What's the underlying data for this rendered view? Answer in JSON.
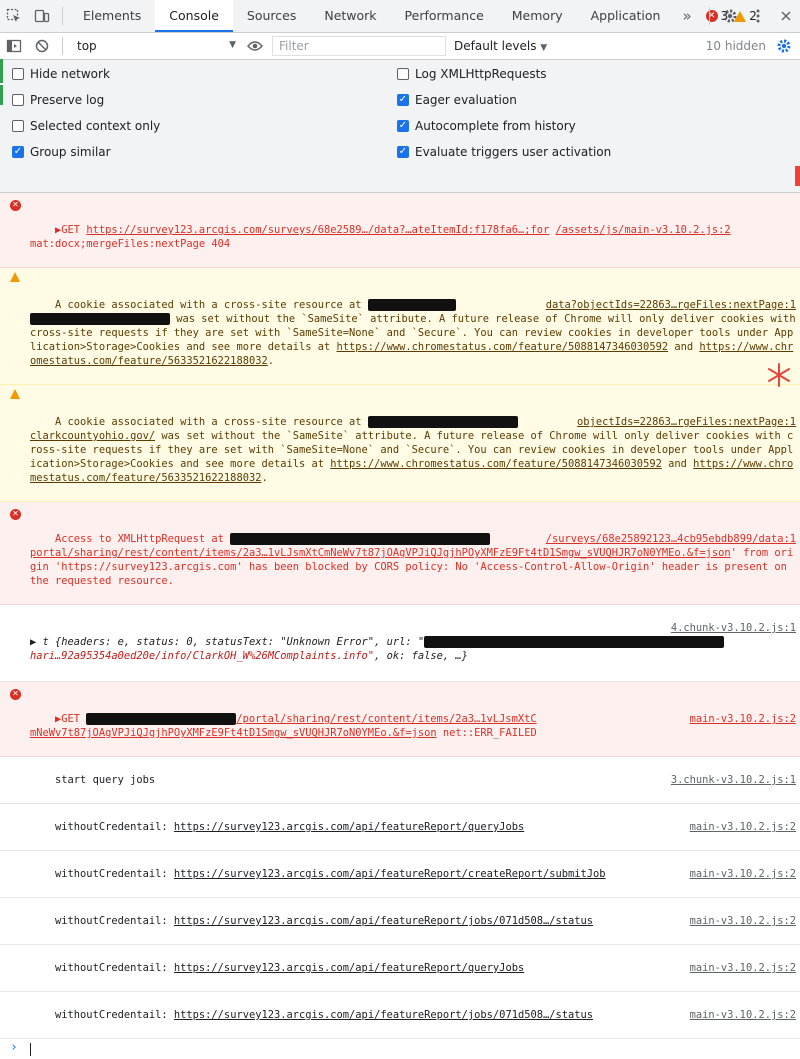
{
  "tabs": [
    "Elements",
    "Console",
    "Sources",
    "Network",
    "Performance",
    "Memory",
    "Application"
  ],
  "active_tab": "Console",
  "more_tabs": "»",
  "error_count": "3",
  "warning_count": "2",
  "toolbar": {
    "context": "top",
    "filter_placeholder": "Filter",
    "levels": "Default levels",
    "hidden": "10 hidden"
  },
  "settings": {
    "left": [
      {
        "label": "Hide network",
        "checked": false
      },
      {
        "label": "Preserve log",
        "checked": false
      },
      {
        "label": "Selected context only",
        "checked": false
      },
      {
        "label": "Group similar",
        "checked": true
      }
    ],
    "right": [
      {
        "label": "Log XMLHttpRequests",
        "checked": false
      },
      {
        "label": "Eager evaluation",
        "checked": true
      },
      {
        "label": "Autocomplete from history",
        "checked": true
      },
      {
        "label": "Evaluate triggers user activation",
        "checked": true
      }
    ]
  },
  "messages": {
    "m1": {
      "prefix": "▶GET ",
      "url": "https://survey123.arcgis.com/surveys/68e2589…/data?…ateItemId:f178fa6…;for",
      "mid": " ",
      "src": "/assets/js/main-v3.10.2.js:2",
      "tail": "mat:docx;mergeFiles:nextPage 404"
    },
    "m2": {
      "line1": "A cookie associated with a cross-site resource at ",
      "src": "data?objectIds=22863…rgeFiles:nextPage:1",
      "line2": " was set without the `SameSite` attribute. A future release of Chrome will only deliver cookies with cross-site requests if they are set with `SameSite=None` and `Secure`. You can review cookies in developer tools under Application>Storage>Cookies and see more details at ",
      "link1": "https://www.chromestatus.com/feature/5088147346030592",
      "and": " and ",
      "link2": "https://www.chromestatus.com/feature/5633521622188032",
      "end": "."
    },
    "m3": {
      "line1": "A cookie associated with a cross-site resource at ",
      "src": "objectIds=22863…rgeFiles:nextPage:1",
      "domain": "clarkcountyohio.gov/",
      "line2": " was set without the `SameSite` attribute. A future release of Chrome will only deliver cookies with cross-site requests if they are set with `SameSite=None` and `Secure`. You can review cookies in developer tools under Application>Storage>Cookies and see more details at ",
      "link1": "https://www.chromestatus.com/feature/5088147346030592",
      "and": " and ",
      "link2": "https://www.chromestatus.com/feature/5633521622188032",
      "end": "."
    },
    "m4": {
      "start": "Access to XMLHttpRequest at ",
      "src": "/surveys/68e25892123…4cb95ebdb899/data:1",
      "url": "portal/sharing/rest/content/items/2a3…1vLJsmXtCmNeWv7t87jOAgVPJiQJgjhPOyXMFzE9Ft4tD1Smgw_sVUQHJR7oN0YMEo.&f=json",
      "rest": "' from origin 'https://survey123.arcgis.com' has been blocked by CORS policy: No 'Access-Control-Allow-Origin' header is present on the requested resource."
    },
    "m5": {
      "src": "4.chunk-v3.10.2.js:1",
      "obj_start": "▶ t {headers: e, status: 0, statusText: \"Unknown Error\", url: \"",
      "obj_mid": "hari…92a95354a0ed20e/info/ClarkOH_W%26MComplaints.info\"",
      "obj_end": ", ok: false, …}"
    },
    "m6": {
      "prefix": "▶GET ",
      "url": "/portal/sharing/rest/content/items/2a3…1vLJsmXtC",
      "src": "main-v3.10.2.js:2",
      "url2": "mNeWv7t87jOAgVPJiQJgjhPOyXMFzE9Ft4tD1Smgw_sVUQHJR7oN0YMEo.&f=json",
      "tail": " net::ERR_FAILED"
    },
    "logs": [
      {
        "text": "start query jobs",
        "url": "",
        "src": "3.chunk-v3.10.2.js:1"
      },
      {
        "text": "withoutCredentail: ",
        "url": "https://survey123.arcgis.com/api/featureReport/queryJobs",
        "src": "main-v3.10.2.js:2"
      },
      {
        "text": "withoutCredentail: ",
        "url": "https://survey123.arcgis.com/api/featureReport/createReport/submitJob",
        "src": "main-v3.10.2.js:2"
      },
      {
        "text": "withoutCredentail: ",
        "url": "https://survey123.arcgis.com/api/featureReport/jobs/071d508…/status",
        "src": "main-v3.10.2.js:2"
      },
      {
        "text": "withoutCredentail: ",
        "url": "https://survey123.arcgis.com/api/featureReport/queryJobs",
        "src": "main-v3.10.2.js:2"
      },
      {
        "text": "withoutCredentail: ",
        "url": "https://survey123.arcgis.com/api/featureReport/jobs/071d508…/status",
        "src": "main-v3.10.2.js:2"
      }
    ]
  },
  "prompt": "›",
  "colors": {
    "accent": "#1a73e8",
    "error": "#d93025",
    "warning": "#f29900"
  }
}
